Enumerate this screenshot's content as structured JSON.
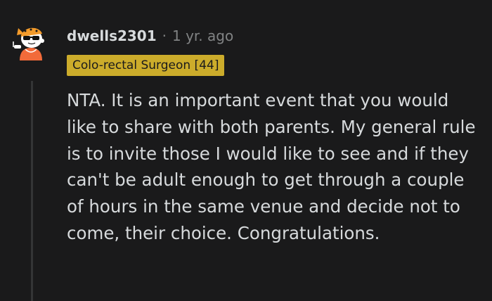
{
  "comment": {
    "username": "dwells2301",
    "separator": "·",
    "timestamp": "1 yr. ago",
    "flair": "Colo-rectal Surgeon [44]",
    "body": "NTA. It is an important event that you would like to share with both parents. My general rule is to invite those I would like to see and if they can't be adult enough to get through a couple of hours in the same venue and decide not to come, their choice. Congratulations."
  },
  "colors": {
    "background": "#1a1a1b",
    "text": "#d7dadc",
    "muted": "#818384",
    "flair_bg": "#ccac2b",
    "thread_line": "#343536"
  },
  "icons": {
    "avatar": "snoo-avatar-icon"
  }
}
